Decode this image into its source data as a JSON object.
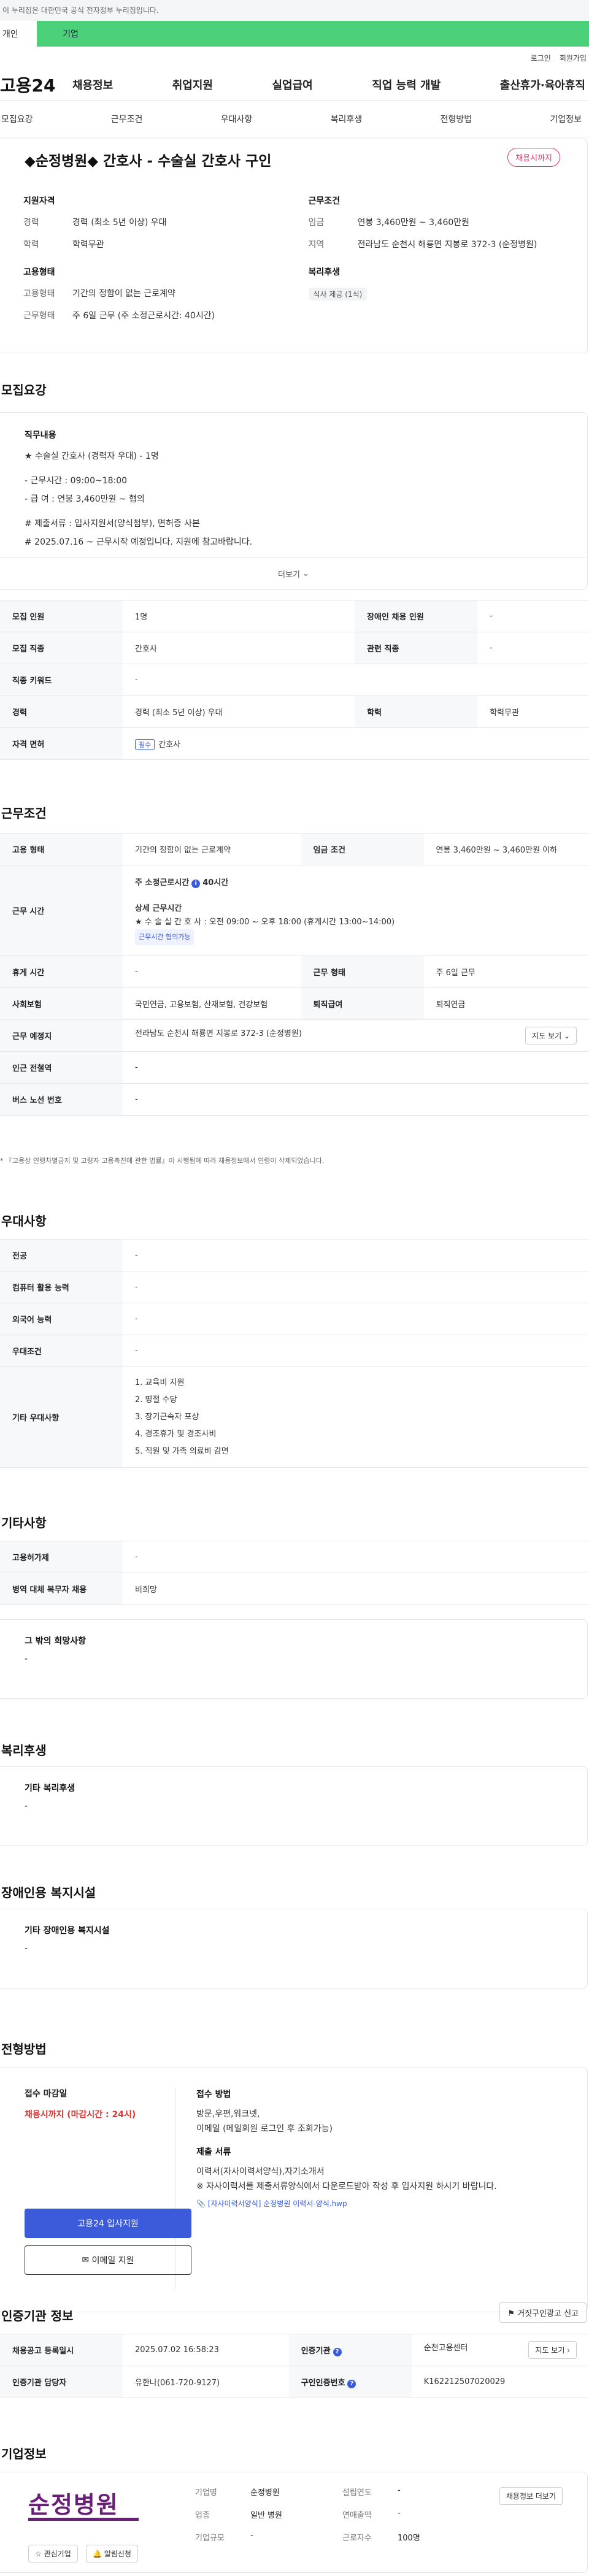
{
  "topbar": {
    "text": "이 누리집은 대한민국 공식 전자정부 누리집입니다."
  },
  "userbar": {
    "tab_individual": "개인",
    "tab_company": "기업"
  },
  "util": {
    "login": "로그인",
    "join": "회원가입"
  },
  "gnb": {
    "logo": "고용24",
    "menu": [
      "채용정보",
      "취업지원",
      "실업급여",
      "직업 능력 개발",
      "출산휴가·육아휴직"
    ]
  },
  "anchors": [
    "모집요강",
    "근무조건",
    "우대사항",
    "복리후생",
    "전형방법",
    "기업정보"
  ],
  "title": {
    "heading": "◆순정병원◆ 간호사 - 수술실 간호사 구인",
    "badge": "채용시까지"
  },
  "summary": {
    "qual": {
      "title": "지원자격",
      "career_k": "경력",
      "career_v": "경력 (최소 5년 이상) 우대",
      "edu_k": "학력",
      "edu_v": "학력무관"
    },
    "emp": {
      "title": "고용형태",
      "type_k": "고용형태",
      "type_v": "기간의 정함이 없는 근로계약",
      "work_k": "근무형태",
      "work_v": "주 6일 근무 (주 소정근로시간: 40시간)"
    },
    "cond": {
      "title": "근무조건",
      "wage_k": "임금",
      "wage_v": "연봉 3,460만원 ~ 3,460만원",
      "area_k": "지역",
      "area_v": "전라남도 순천시 해룡면 지봉로 372-3 (순정병원)"
    },
    "welfare": {
      "title": "복리후생",
      "chip": "식사 제공 (1식)"
    }
  },
  "recruit": {
    "section": "모집요강",
    "desc_label": "직무내용",
    "desc_lines": [
      "★ 수술실 간호사 (경력자 우대) - 1명",
      "- 근무시간 : 09:00~18:00",
      "- 급      여 : 연봉 3,460만원 ~ 협의",
      "# 제출서류 : 입사지원서(양식첨부), 면허증 사본",
      "# 2025.07.16 ~ 근무시작 예정입니다. 지원에 참고바랍니다."
    ],
    "more": "더보기",
    "rows": {
      "count_k": "모집 인원",
      "count_v": "1명",
      "dis_k": "장애인 채용 인원",
      "dis_v": "-",
      "job_k": "모집 직종",
      "job_v": "간호사",
      "rel_k": "관련 직종",
      "rel_v": "-",
      "kw_k": "직종 키워드",
      "kw_v": "-",
      "career_k": "경력",
      "career_v": "경력 (최소 5년 이상) 우대",
      "edu_k": "학력",
      "edu_v": "학력무관",
      "lic_k": "자격 면허",
      "lic_tag": "필수",
      "lic_v": "간호사"
    }
  },
  "work": {
    "section": "근무조건",
    "emp_k": "고용 형태",
    "emp_v": "기간의 정함이 없는 근로계약",
    "wage_k": "임금 조건",
    "wage_v": "연봉 3,460만원 ~ 3,460만원 이하",
    "time_k": "근무 시간",
    "time_main": "주 소정근로시간",
    "time_hours": "40시간",
    "time_detail_label": "상세 근무시간",
    "time_detail": "★ 수 술 실 간 호 사 : 오전 09:00 ~ 오후 18:00 (휴게시간 13:00~14:00)",
    "time_tag": "근무시간 협의가능",
    "rest_k": "휴게 시간",
    "rest_v": "-",
    "form_k": "근무 형태",
    "form_v": "주 6일 근무",
    "ins_k": "사회보험",
    "ins_v": "국민연금, 고용보험, 산재보험, 건강보험",
    "ret_k": "퇴직급여",
    "ret_v": "퇴직연금",
    "place_k": "근무 예정지",
    "place_v": "전라남도 순천시 해룡면 지봉로 372-3 (순정병원)",
    "map": "지도 보기",
    "sub_k": "인근 전철역",
    "sub_v": "-",
    "bus_k": "버스 노선 번호",
    "bus_v": "-",
    "note": "* 『고용상 연령차별금지 및 고령자 고용촉진에 관한 법률』이 시행됨에 따라 채용정보에서 연령이 삭제되었습니다."
  },
  "prefer": {
    "section": "우대사항",
    "major_k": "전공",
    "major_v": "-",
    "pc_k": "컴퓨터 활용 능력",
    "pc_v": "-",
    "lang_k": "외국어 능력",
    "lang_v": "-",
    "cond_k": "우대조건",
    "cond_v": "-",
    "etc_k": "기타 우대사항",
    "etc_list": [
      "1. 교육비 지원",
      "2. 명절 수당",
      "3. 장기근속자 포상",
      "4. 경조휴가 및 경조사비",
      "5. 직원 및 가족 의료비 감면"
    ]
  },
  "other": {
    "section": "기타사항",
    "emp_k": "고용허가제",
    "emp_v": "-",
    "mil_k": "병역 대체 복무자 채용",
    "mil_v": "비희망",
    "etc_label": "그 밖의 희망사항",
    "etc_v": "-"
  },
  "welfare": {
    "section": "복리후생",
    "label": "기타 복리후생",
    "value": "-"
  },
  "disability": {
    "section": "장애인용 복지시설",
    "label": "기타 장애인용 복지시설",
    "value": "-"
  },
  "apply": {
    "section": "전형방법",
    "deadline_label": "접수 마감일",
    "deadline_v": "채용시까지 (마감시간 : 24시)",
    "method_label": "접수 방법",
    "method_v1": "방문,우편,워크넷,",
    "method_v2": "이메일 (메일회원 로그인 후 조회가능)",
    "docs_label": "제출 서류",
    "docs_v1": "이력서(자사이력서양식),자기소개서",
    "docs_v2": "※ 자사이력서를 제출서류양식에서 다운로드받아 작성 후 입사지원 하시기 바랍니다.",
    "file": "[자사이력서양식] 순정병원 이력서-양식.hwp",
    "apply_btn": "고용24 입사지원",
    "email_btn": "이메일 지원"
  },
  "cert": {
    "section": "인증기관 정보",
    "report": "거짓구인광고 신고",
    "reg_k": "채용공고 등록일시",
    "reg_v": "2025.07.02 16:58:23",
    "org_k": "인증기관",
    "org_v": "순천고용센터",
    "map": "지도 보기",
    "mgr_k": "인증기관 담당자",
    "mgr_v": "유한나(061-720-9127)",
    "num_k": "구인인증번호",
    "num_v": "K162212507020029"
  },
  "company": {
    "section": "기업정보",
    "logo": "순정병원",
    "name_k": "기업명",
    "name_v": "순정병원",
    "est_k": "설립연도",
    "est_v": "-",
    "ind_k": "업종",
    "ind_v": "일반 병원",
    "sales_k": "연매출액",
    "sales_v": "-",
    "size_k": "기업규모",
    "size_v": "-",
    "emp_k": "근로자수",
    "emp_v": "100명",
    "jobs_btn": "채용정보 더보기",
    "interest": "관심기업",
    "alert": "알림신청"
  }
}
